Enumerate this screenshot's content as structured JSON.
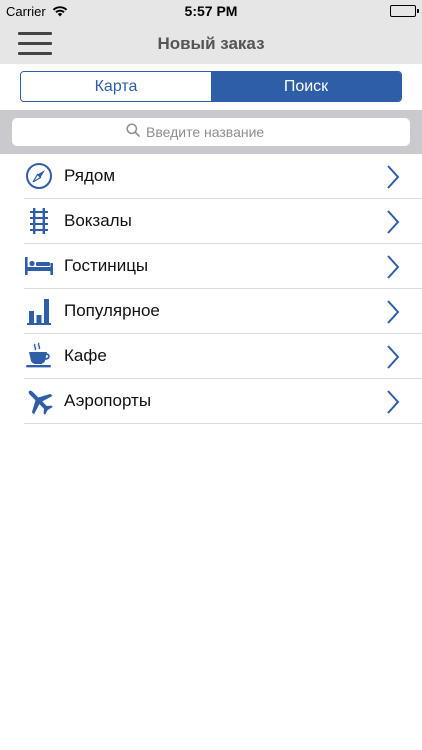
{
  "status_bar": {
    "carrier": "Carrier",
    "time": "5:57 PM",
    "wifi_icon": "wifi-icon",
    "battery_icon": "battery-icon",
    "battery_level": 1.0
  },
  "nav": {
    "title": "Новый заказ",
    "menu_icon": "hamburger-menu-icon"
  },
  "segments": {
    "map_label": "Карта",
    "search_label": "Поиск",
    "selected": "Поиск"
  },
  "search": {
    "placeholder": "Введите название",
    "value": "",
    "icon": "search-icon"
  },
  "list": {
    "items": [
      {
        "label": "Рядом",
        "icon": "compass-icon"
      },
      {
        "label": "Вокзалы",
        "icon": "railway-icon"
      },
      {
        "label": "Гостиницы",
        "icon": "bed-icon"
      },
      {
        "label": "Популярное",
        "icon": "bar-chart-icon"
      },
      {
        "label": "Кафе",
        "icon": "coffee-cup-icon"
      },
      {
        "label": "Аэропорты",
        "icon": "airplane-icon"
      }
    ]
  },
  "colors": {
    "accent": "#2f5ea8",
    "bar_background": "#e6e6e6",
    "search_background": "#c9c9ce"
  }
}
